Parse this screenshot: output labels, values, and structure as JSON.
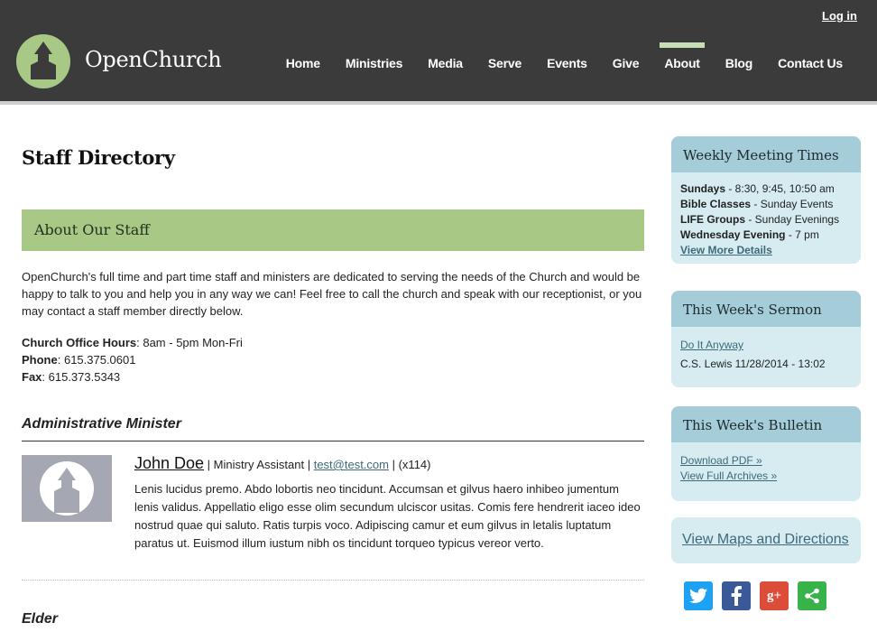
{
  "header": {
    "brand": "OpenChurch",
    "login_label": "Log in",
    "nav": [
      "Home",
      "Ministries",
      "Media",
      "Serve",
      "Events",
      "Give",
      "About",
      "Blog",
      "Contact Us"
    ],
    "active_nav": "About"
  },
  "main": {
    "page_title": "Staff Directory",
    "about_heading": "About Our Staff",
    "intro": "OpenChurch's full time and part time staff and ministers are dedicated to serving the needs of the Church and would be happy to talk to you and help you in any way we can! Feel free to call the church and speak with our receptionist, or you may contact a staff member directly below.",
    "hours_label": "Church Office Hours",
    "hours_value": ": 8am - 5pm Mon-Fri",
    "phone_label": "Phone",
    "phone_value": ": 615.375.0601",
    "fax_label": "Fax",
    "fax_value": ": 615.373.5343",
    "sections": [
      {
        "title": "Administrative Minister",
        "staff": {
          "name": "John Doe",
          "sep1": " | ",
          "role": "Ministry Assistant",
          "sep2": " | ",
          "email": "test@test.com",
          "sep3": " | ",
          "ext": "(x114)",
          "bio": "Lenis lucidus premo. Abdo lobortis neo tincidunt. Accumsan et gilvus haero inhibeo jumentum lenis validus. Appellatio eligo esse olim secundum ulciscor usitas. Comis fere hendrerit iaceo ideo nostrud quae qui saluto. Ratis turpis voco. Adipiscing camur et eum gilvus in letalis luptatum paratus ut. Euismod illum iustum nibh os tincidunt torqueo typicus vereor verto."
        }
      },
      {
        "title": "Elder"
      }
    ]
  },
  "sidebar": {
    "meeting": {
      "title": "Weekly Meeting Times",
      "rows": [
        {
          "label": "Sundays",
          "value": " - 8:30, 9:45, 10:50 am"
        },
        {
          "label": "Bible Classes",
          "value": " - Sunday Events"
        },
        {
          "label": "LIFE Groups",
          "value": " - Sunday Evenings"
        },
        {
          "label": "Wednesday Evening",
          "value": " - 7 pm"
        }
      ],
      "more_link": "View More Details"
    },
    "sermon": {
      "title": "This Week's Sermon",
      "link": "Do It Anyway",
      "meta": "C.S. Lewis 11/28/2014 - 13:02"
    },
    "bulletin": {
      "title": "This Week's Bulletin",
      "download": "Download PDF »",
      "archives": "View Full Archives »"
    },
    "maps_link": "View Maps and Directions",
    "social_icons": [
      "twitter-icon",
      "facebook-icon",
      "google-plus-icon",
      "share-icon"
    ]
  },
  "colors": {
    "header_bg": "#3b3b3b",
    "accent_green": "#a7c985",
    "sidebar_bg": "#d6ecf1",
    "sidebar_head": "#a4ccd9",
    "link": "#3c6a7a"
  }
}
